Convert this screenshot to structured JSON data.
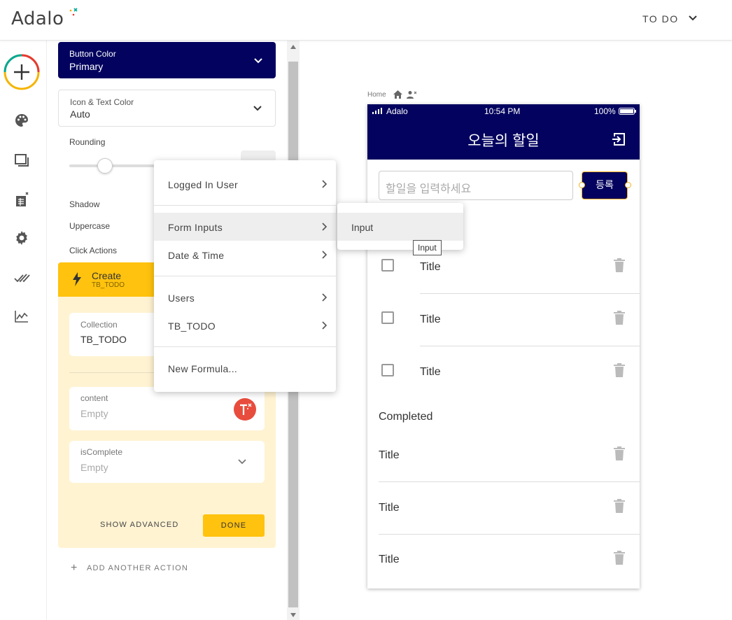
{
  "brand": {
    "logo_text": "Adalo",
    "accent": "#ffc20e",
    "phone_primary": "#03035f"
  },
  "header": {
    "app_name": "TO DO"
  },
  "rail": {
    "icons": [
      "add-component-icon",
      "branding-palette-icon",
      "screens-icon",
      "database-icon",
      "settings-icon",
      "publish-check-icon",
      "analytics-icon"
    ]
  },
  "panel": {
    "button_color": {
      "label": "Button Color",
      "value": "Primary"
    },
    "icon_text_color": {
      "label": "Icon & Text Color",
      "value": "Auto"
    },
    "rounding_label": "Rounding",
    "shadow_label": "Shadow",
    "uppercase_label": "Uppercase",
    "click_actions_label": "Click Actions",
    "action": {
      "title": "Create",
      "subtitle": "TB_TODO",
      "collection_label": "Collection",
      "collection_value": "TB_TODO",
      "content_label": "content",
      "content_value": "Empty",
      "iscomplete_label": "isComplete",
      "iscomplete_value": "Empty",
      "show_advanced": "SHOW ADVANCED",
      "done": "DONE"
    },
    "add_another_action": "ADD ANOTHER ACTION"
  },
  "magic_menu": {
    "items": [
      {
        "label": "Logged In User"
      },
      {
        "label": "Form Inputs"
      },
      {
        "label": "Date & Time"
      },
      {
        "label": "Users"
      },
      {
        "label": "TB_TODO"
      },
      {
        "label": "New Formula..."
      }
    ],
    "submenu_item": "Input",
    "tooltip": "Input"
  },
  "canvas": {
    "breadcrumb": "Home",
    "status": {
      "carrier": "Adalo",
      "time": "10:54 PM",
      "battery": "100%"
    },
    "screen_title": "오늘의 할일",
    "input_placeholder": "할일을 입력하세요",
    "register_button": "등록",
    "todo_items": [
      "Title",
      "Title",
      "Title"
    ],
    "completed_title": "Completed",
    "completed_items": [
      "Title",
      "Title",
      "Title"
    ]
  }
}
